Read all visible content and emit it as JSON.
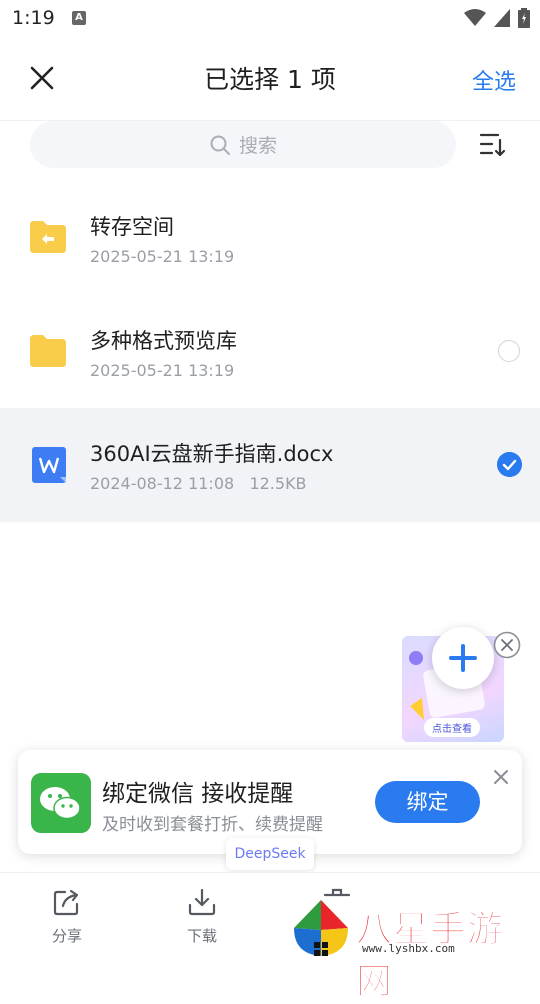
{
  "status_bar": {
    "time": "1:19"
  },
  "header": {
    "title": "已选择 1 项",
    "select_all": "全选"
  },
  "search": {
    "placeholder": "搜索"
  },
  "files": [
    {
      "name": "转存空间",
      "meta": "2025-05-21 13:19",
      "type": "folder-transfer",
      "selected": false
    },
    {
      "name": "多种格式预览库",
      "meta": "2025-05-21 13:19",
      "type": "folder",
      "selected": false
    },
    {
      "name": "360AI云盘新手指南.docx",
      "meta": "2024-08-12 11:08   12.5KB",
      "type": "doc",
      "selected": true
    }
  ],
  "promo": {
    "button": "点击查看"
  },
  "bind_card": {
    "title": "绑定微信 接收提醒",
    "subtitle": "及时收到套餐打折、续费提醒",
    "button": "绑定"
  },
  "deepseek": {
    "label": "DeepSeek"
  },
  "bottom_bar": {
    "share": "分享",
    "download": "下载"
  },
  "watermark": {
    "text": "八星手游网",
    "url": "www.lyshbx.com"
  },
  "colors": {
    "accent": "#2a7bef",
    "folder": "#f9cd4a",
    "wechat": "#39b54a"
  }
}
